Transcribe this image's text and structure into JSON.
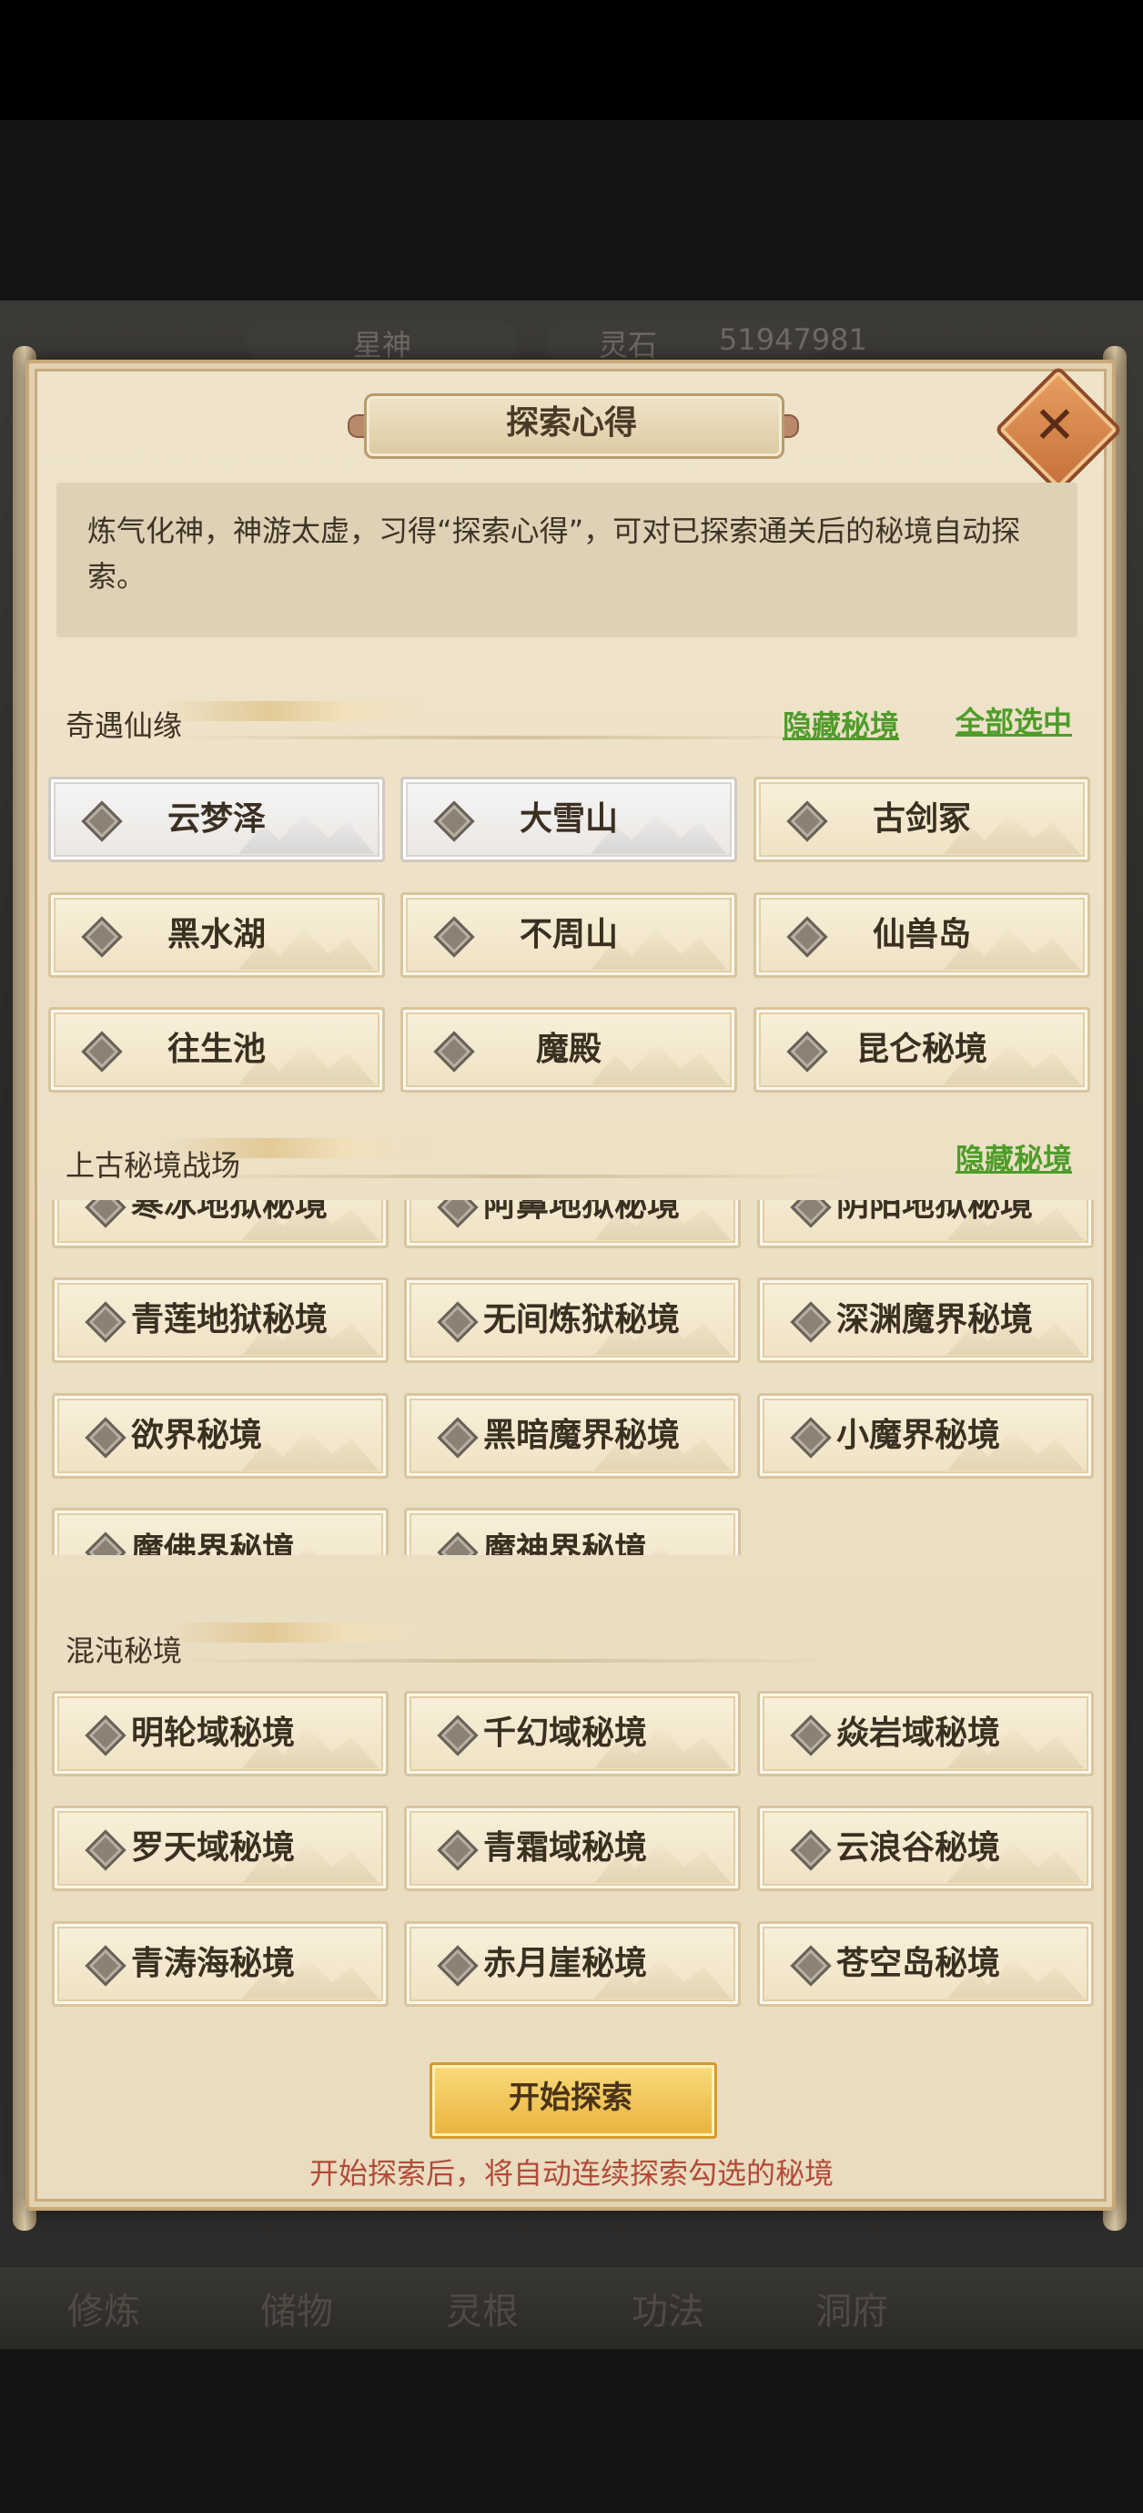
{
  "background": {
    "topbar": {
      "name": "星神",
      "currency_label": "灵石",
      "currency_value": "51947981"
    },
    "bottom_nav": [
      "修炼",
      "储物",
      "灵根",
      "功法",
      "洞府"
    ]
  },
  "dialog": {
    "title": "探索心得",
    "description": "炼气化神，神游太虚，习得“探索心得”，可对已探索通关后的秘境自动探索。"
  },
  "sections": [
    {
      "title": "奇遇仙缘",
      "hide_link": "隐藏秘境",
      "select_all_link": "全部选中",
      "items": [
        "云梦泽",
        "大雪山",
        "古剑冢",
        "黑水湖",
        "不周山",
        "仙兽岛",
        "往生池",
        "魔殿",
        "昆仑秘境"
      ],
      "selected": [
        true,
        true,
        false,
        false,
        false,
        false,
        false,
        false,
        false
      ]
    },
    {
      "title": "上古秘境战场",
      "hide_link": "隐藏秘境",
      "items": [
        "寒冰地狱秘境",
        "阿鼻地狱秘境",
        "阴阳地狱秘境",
        "青莲地狱秘境",
        "无间炼狱秘境",
        "深渊魔界秘境",
        "欲界秘境",
        "黑暗魔界秘境",
        "小魔界秘境",
        "魔佛界秘境",
        "魔神界秘境"
      ]
    },
    {
      "title": "混沌秘境",
      "items": [
        "明轮域秘境",
        "千幻域秘境",
        "焱岩域秘境",
        "罗天域秘境",
        "青霜域秘境",
        "云浪谷秘境",
        "青涛海秘境",
        "赤月崖秘境",
        "苍空岛秘境"
      ]
    }
  ],
  "start_button": "开始探索",
  "hint": "开始探索后，将自动连续探索勾选的秘境",
  "colors": {
    "link": "#4f9c2a",
    "hint": "#b14b39",
    "start": "#e9b23c"
  }
}
